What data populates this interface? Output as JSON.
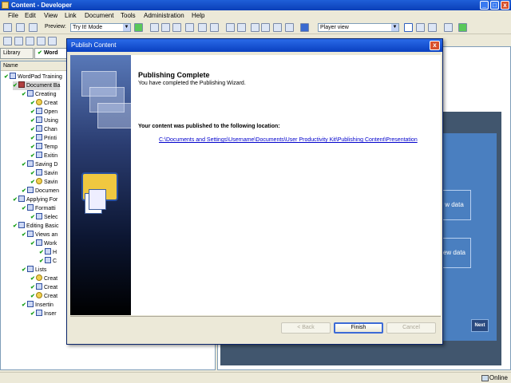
{
  "window": {
    "title": "Content - Developer",
    "min_label": "_",
    "max_label": "□",
    "close_label": "x"
  },
  "menu": [
    "File",
    "Edit",
    "View",
    "Link",
    "Document",
    "Tools",
    "Administration",
    "Help"
  ],
  "toolbar": {
    "preview_label": "Preview:",
    "preview_mode": "Try It! Mode",
    "view_mode": "Player view"
  },
  "tabs": {
    "library": "Library",
    "word": "Word"
  },
  "tree": {
    "header": "Name",
    "items": [
      {
        "label": "WordPad Training",
        "level": 0,
        "icon": "book",
        "check": true
      },
      {
        "label": "Document Ba",
        "level": 1,
        "icon": "mod",
        "check": true
      },
      {
        "label": "Creating",
        "level": 2,
        "icon": "book",
        "check": true
      },
      {
        "label": "Creat",
        "level": 3,
        "icon": "bulb",
        "check": true
      },
      {
        "label": "Open",
        "level": 3,
        "icon": "book",
        "check": true
      },
      {
        "label": "Using",
        "level": 3,
        "icon": "book",
        "check": true
      },
      {
        "label": "Chan",
        "level": 3,
        "icon": "book",
        "check": true
      },
      {
        "label": "Printi",
        "level": 3,
        "icon": "book",
        "check": true
      },
      {
        "label": "Temp",
        "level": 3,
        "icon": "book",
        "check": true
      },
      {
        "label": "Exitin",
        "level": 3,
        "icon": "book",
        "check": true
      },
      {
        "label": "Saving D",
        "level": 2,
        "icon": "book",
        "check": true
      },
      {
        "label": "Savin",
        "level": 3,
        "icon": "book",
        "check": true
      },
      {
        "label": "Savin",
        "level": 3,
        "icon": "bulb",
        "check": true
      },
      {
        "label": "Documen",
        "level": 2,
        "icon": "book",
        "check": true
      },
      {
        "label": "Applying For",
        "level": 1,
        "icon": "book",
        "check": true
      },
      {
        "label": "Formatti",
        "level": 2,
        "icon": "book",
        "check": true
      },
      {
        "label": "Selec",
        "level": 3,
        "icon": "book",
        "check": true
      },
      {
        "label": "Editing Basic",
        "level": 1,
        "icon": "book",
        "check": true
      },
      {
        "label": "Views an",
        "level": 2,
        "icon": "book",
        "check": true
      },
      {
        "label": "Work",
        "level": 3,
        "icon": "book",
        "check": true
      },
      {
        "label": "H",
        "level": 4,
        "icon": "book",
        "check": true
      },
      {
        "label": "C",
        "level": 4,
        "icon": "book",
        "check": true
      },
      {
        "label": "Lists",
        "level": 2,
        "icon": "book",
        "check": true
      },
      {
        "label": "Creat",
        "level": 3,
        "icon": "bulb",
        "check": true
      },
      {
        "label": "Creat",
        "level": 3,
        "icon": "book",
        "check": true
      },
      {
        "label": "Creat",
        "level": 3,
        "icon": "bulb",
        "check": true
      },
      {
        "label": "Insertin",
        "level": 2,
        "icon": "book",
        "check": true
      },
      {
        "label": "Inser",
        "level": 3,
        "icon": "book",
        "check": true
      }
    ]
  },
  "preview": {
    "box1": "w data",
    "box2": "ew data",
    "next": "Next"
  },
  "status": {
    "online": "Online"
  },
  "dialog": {
    "title": "Publish Content",
    "heading": "Publishing Complete",
    "subtitle": "You have completed the Publishing Wizard.",
    "location_label": "Your content was published to the following location:",
    "location_link": "C:\\Documents and Settings\\Username\\Documents\\User Productivity Kit\\Publishing Content\\Presentation",
    "back_button": "< Back",
    "finish_button": "Finish",
    "cancel_button": "Cancel",
    "close_label": "x"
  },
  "colors": {
    "title_blue": "#0a40c0",
    "link_blue": "#0000cc",
    "check_green": "#18a018"
  }
}
